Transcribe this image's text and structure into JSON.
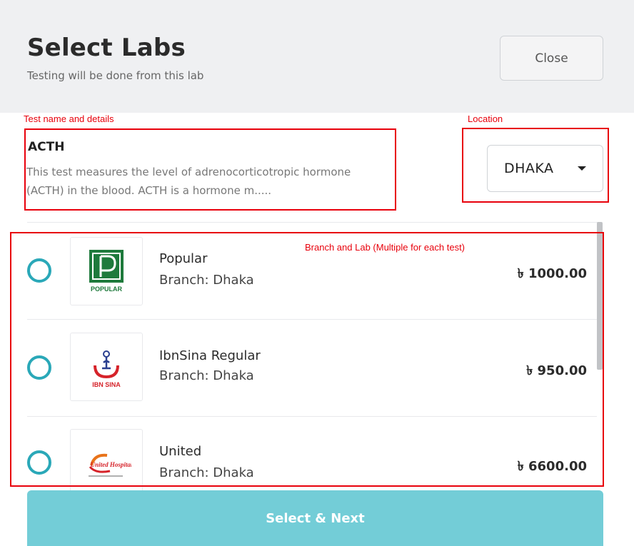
{
  "header": {
    "title": "Select Labs",
    "subtitle": "Testing will be done from this lab",
    "close_label": "Close"
  },
  "annotations": {
    "test_details": "Test name and details",
    "location": "Location",
    "branch_lab": "Branch and Lab (Multiple for each test)"
  },
  "test": {
    "name": "ACTH",
    "description_line1": "This test measures the level of adrenocorticotropic hormone",
    "description_line2": "(ACTH) in the blood. ACTH is a hormone m....."
  },
  "location": {
    "selected": "DHAKA"
  },
  "labs": [
    {
      "name": "Popular",
      "branch": "Branch: Dhaka",
      "price": "৳ 1000.00",
      "logo": "popular-logo",
      "logo_text": "POPULAR",
      "selected": false
    },
    {
      "name": "IbnSina Regular",
      "branch": "Branch: Dhaka",
      "price": "৳ 950.00",
      "logo": "ibnsina-logo",
      "logo_text": "IBN SINA",
      "selected": false
    },
    {
      "name": "United",
      "branch": "Branch: Dhaka",
      "price": "৳ 6600.00",
      "logo": "united-hospital-logo",
      "logo_text": "United Hospital",
      "selected": false
    }
  ],
  "footer": {
    "next_label": "Select & Next"
  },
  "colors": {
    "header_bg": "#eff0f2",
    "accent_teal": "#2aa8b8",
    "button_teal": "#73cdd7",
    "annotation_red": "#e8000b"
  }
}
